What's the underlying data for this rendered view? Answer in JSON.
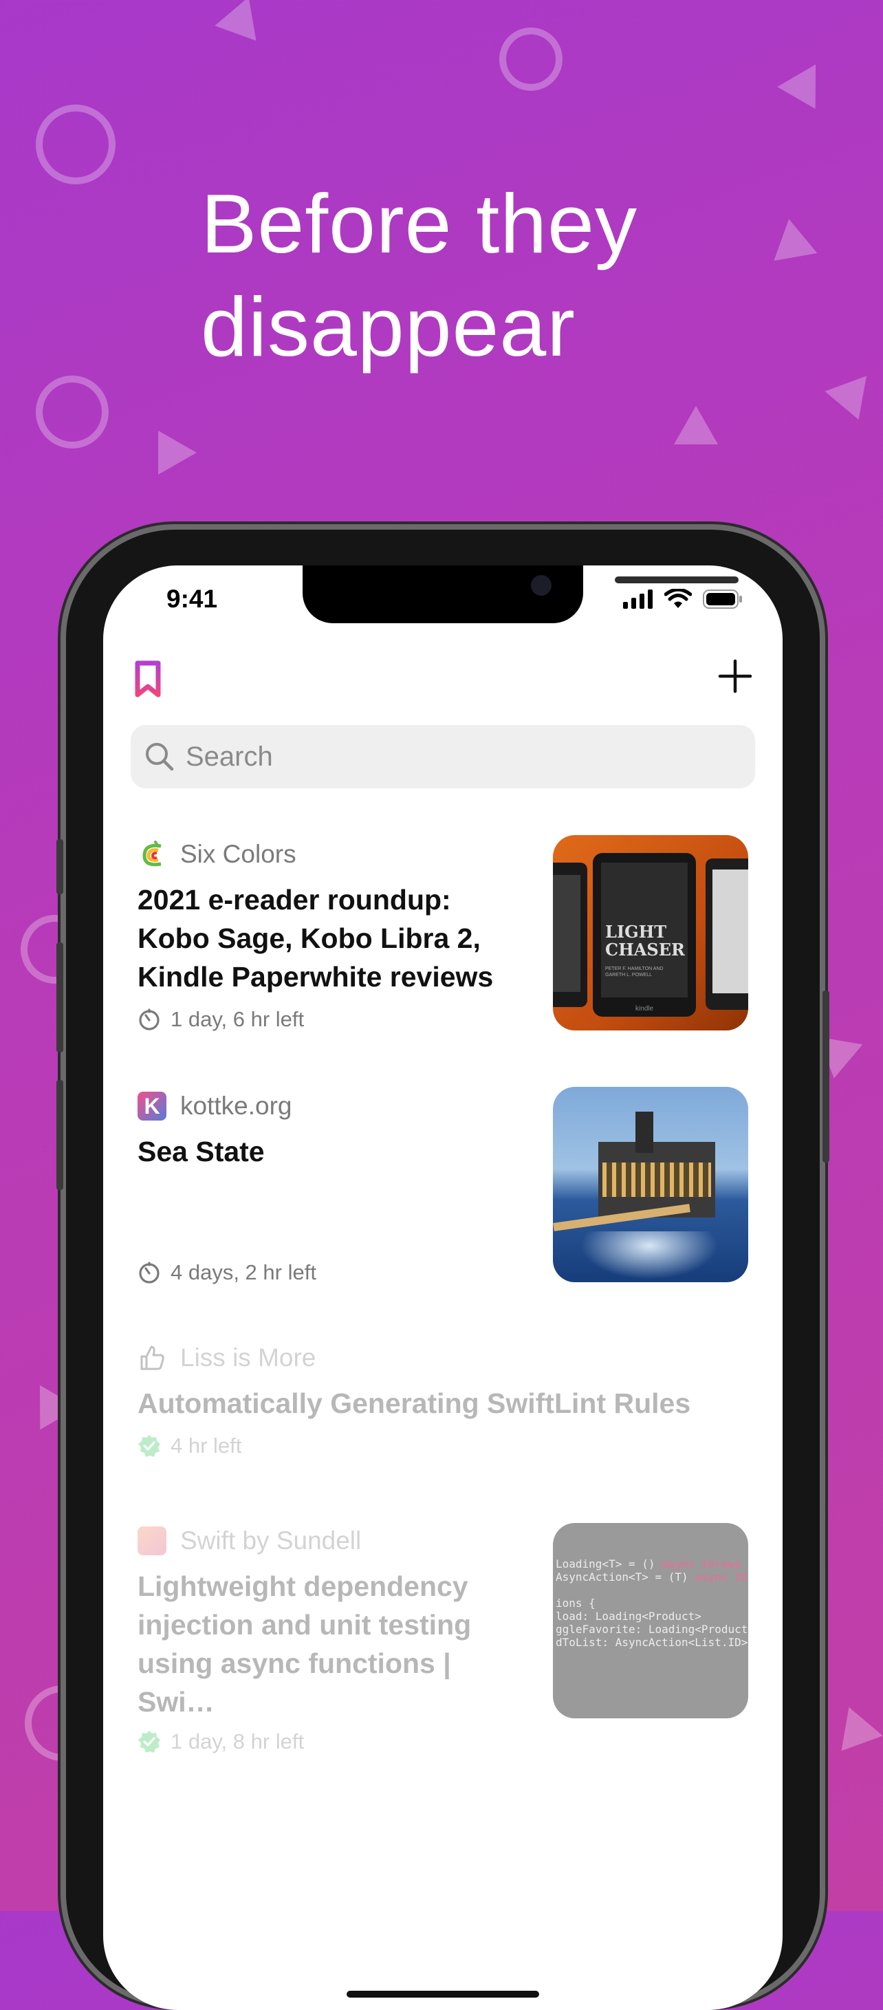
{
  "headline": {
    "line1": "Before they",
    "line2": "disappear"
  },
  "status_bar": {
    "time": "9:41",
    "icons": [
      "signal-icon",
      "wifi-icon",
      "battery-icon"
    ]
  },
  "toolbar": {
    "logo_icon": "bookmark-logo-icon",
    "add_icon": "plus-icon"
  },
  "search": {
    "placeholder": "Search"
  },
  "articles": [
    {
      "source": "Six Colors",
      "title": "2021 e-reader roundup: Kobo Sage, Kobo Libra 2, Kindle Paperwhite reviews",
      "time_left": "1 day, 6 hr left",
      "status": "pending",
      "thumbnail": {
        "subject": "e-readers",
        "cover_title": "LIGHT CHASER",
        "cover_authors": "PETER F. HAMILTON AND GARETH L. POWELL",
        "device_brand": "kindle"
      }
    },
    {
      "source": "kottke.org",
      "title": "Sea State",
      "time_left": "4 days, 2 hr left",
      "status": "pending",
      "thumbnail": {
        "subject": "offshore oil platform at sea"
      }
    },
    {
      "source": "Liss is More",
      "title": "Automatically Generating SwiftLint Rules",
      "time_left": "4 hr left",
      "status": "read"
    },
    {
      "source": "Swift by Sundell",
      "title": "Lightweight dependency injection and unit testing using async functions | Swi…",
      "time_left": "1 day, 8 hr left",
      "status": "read",
      "thumbnail": {
        "subject": "code screenshot",
        "code_lines": [
          [
            "Loading<T> = () ",
            "async throws →"
          ],
          [
            "AsyncAction<T> = (T) ",
            "async th"
          ],
          [
            "",
            ""
          ],
          [
            "ions {",
            ""
          ],
          [
            "load: Loading<Product>",
            ""
          ],
          [
            "ggleFavorite: Loading<Product",
            ""
          ],
          [
            "dToList: AsyncAction<List.ID>",
            ""
          ]
        ]
      }
    }
  ],
  "colors": {
    "background_start": "#a839c9",
    "background_end": "#c23fa6",
    "accent_logo": "#e0457b",
    "check_green": "#34c759"
  }
}
